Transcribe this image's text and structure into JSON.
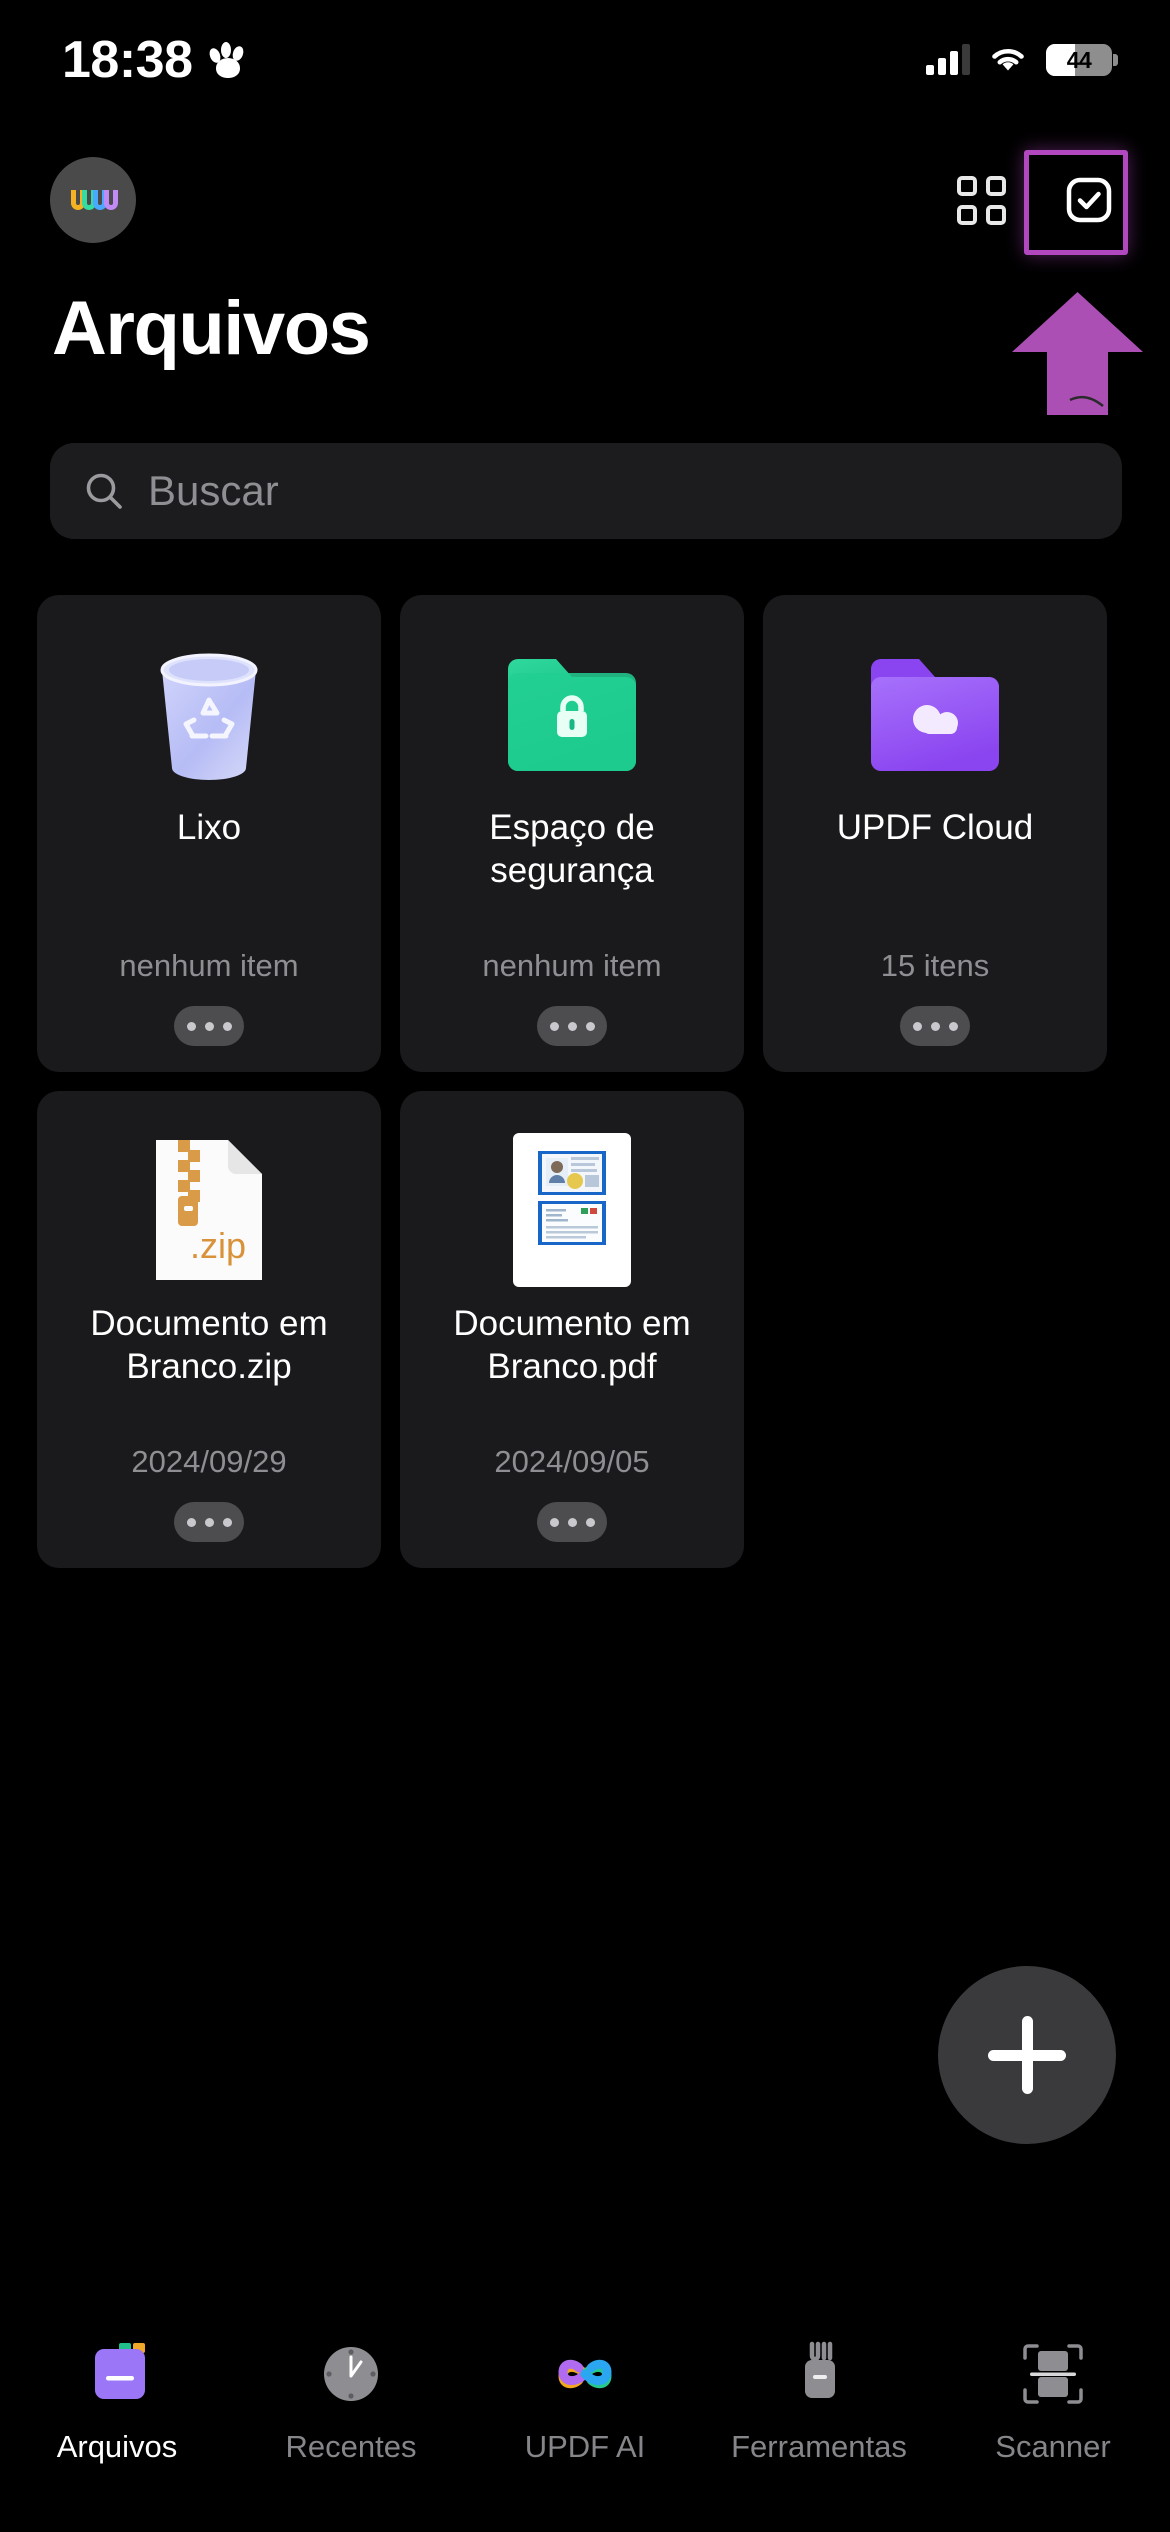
{
  "status_bar": {
    "time": "18:38",
    "paw_icon": "paw-icon",
    "signal_icon": "cellular-signal-icon",
    "wifi_icon": "wifi-icon",
    "battery_percent": "44",
    "battery_level": 44
  },
  "header": {
    "avatar_icon": "user-avatar",
    "grid_view_label": "grid-view-icon",
    "select_label": "select-mode-icon",
    "highlight_color": "#b248c0",
    "annotation_arrow": "arrow-up-annotation"
  },
  "page": {
    "title": "Arquivos"
  },
  "search": {
    "placeholder": "Buscar",
    "value": "",
    "icon": "search-icon"
  },
  "files": [
    {
      "name": "Lixo",
      "subtitle": "nenhum item",
      "icon": "trash-bin-icon",
      "kind": "trash",
      "color": "#b9bdf2"
    },
    {
      "name": "Espaço de segurança",
      "subtitle": "nenhum item",
      "icon": "locked-folder-icon",
      "kind": "folder-lock",
      "color": "#18c08f"
    },
    {
      "name": "UPDF Cloud",
      "subtitle": "15 itens",
      "icon": "cloud-folder-icon",
      "kind": "folder-cloud",
      "color": "#9b5cf6"
    },
    {
      "name": "Documento em Branco.zip",
      "subtitle": "2024/09/29",
      "icon": "zip-file-icon",
      "kind": "zip",
      "color": "#d9983f",
      "extension_label": ".zip"
    },
    {
      "name": "Documento em Branco.pdf",
      "subtitle": "2024/09/05",
      "icon": "pdf-file-icon",
      "kind": "pdf",
      "color": "#1f6fd0"
    }
  ],
  "card_more_label": "more-options-icon",
  "fab": {
    "label": "add-icon"
  },
  "tabs": [
    {
      "label": "Arquivos",
      "icon": "files-folder-icon",
      "active": true
    },
    {
      "label": "Recentes",
      "icon": "clock-icon",
      "active": false
    },
    {
      "label": "UPDF AI",
      "icon": "updf-ai-icon",
      "active": false
    },
    {
      "label": "Ferramentas",
      "icon": "toolbox-icon",
      "active": false
    },
    {
      "label": "Scanner",
      "icon": "scanner-icon",
      "active": false
    }
  ]
}
